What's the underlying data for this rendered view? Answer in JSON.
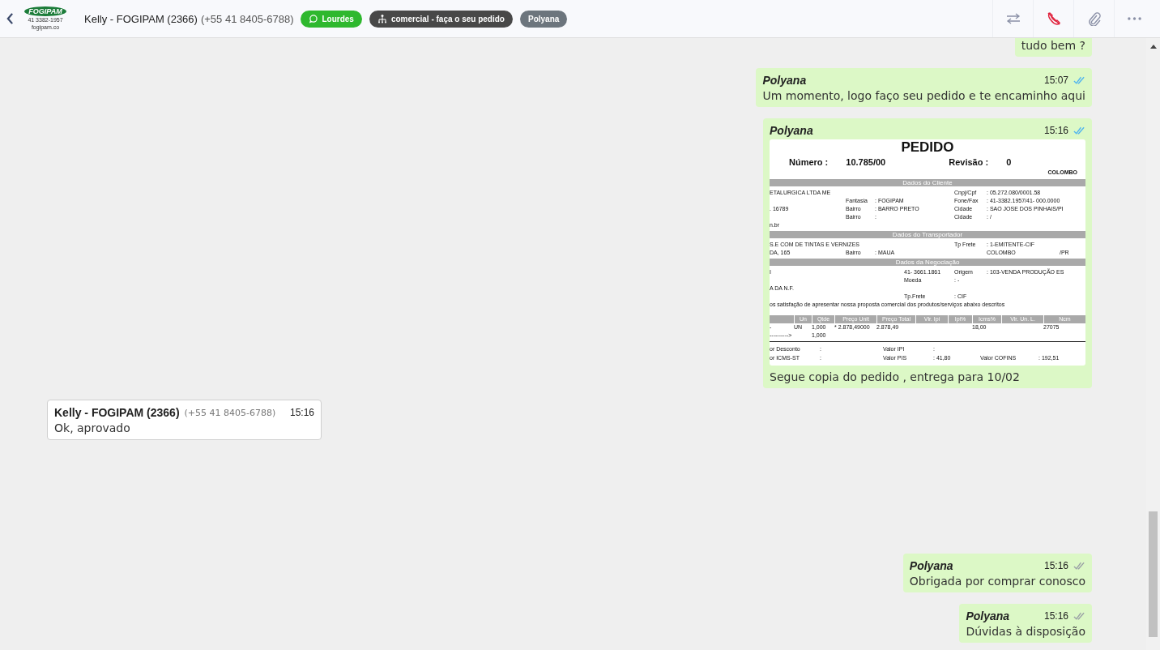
{
  "header": {
    "logo": {
      "name": "FOGIPAM",
      "phone": "41 3382-1957",
      "site": "fogipam.co"
    },
    "contact_name": "Kelly - FOGIPAM (2366)",
    "contact_phone": "(+55 41 8405-6788)",
    "tags": [
      {
        "kind": "whatsapp",
        "label": "Lourdes",
        "color": "#2eb82e"
      },
      {
        "kind": "queue",
        "label": "comercial - faça o seu pedido",
        "color": "#484848"
      },
      {
        "kind": "agent",
        "label": "Polyana",
        "color": "#6c757d"
      }
    ]
  },
  "messages": [
    {
      "kind": "text",
      "outgoing": true,
      "text": "tudo bem ?"
    },
    {
      "kind": "text",
      "outgoing": true,
      "author": "Polyana",
      "time": "15:07",
      "read": true,
      "text": "Um momento, logo faço seu pedido e te encaminho aqui"
    },
    {
      "kind": "document",
      "outgoing": true,
      "author": "Polyana",
      "time": "15:16",
      "read": true,
      "caption": "Segue copia do pedido , entrega para 10/02"
    },
    {
      "kind": "text",
      "outgoing": false,
      "author": "Kelly - FOGIPAM (2366)",
      "phone": "(+55 41 8405-6788)",
      "time": "15:16",
      "text": "Ok, aprovado"
    },
    {
      "kind": "text",
      "outgoing": true,
      "author": "Polyana",
      "time": "15:16",
      "read": false,
      "text": "Obrigada por comprar conosco"
    },
    {
      "kind": "text",
      "outgoing": true,
      "author": "Polyana",
      "time": "15:16",
      "read": false,
      "text": "Dúvidas à disposição"
    }
  ],
  "document": {
    "title": "PEDIDO",
    "number_label": "Número :",
    "number": "10.785/00",
    "revision_label": "Revisão :",
    "revision": "0",
    "city": "COLOMBO",
    "blocks": [
      {
        "kind": "bar",
        "text": "Dados do Cliente"
      },
      {
        "kind": "row",
        "column_1": "ETALURGICA LTDA ME",
        "column_5": "Cnpj/Cpf",
        "column_6": ":  05.272.080/0001.58"
      },
      {
        "kind": "row",
        "column_2": "Fantasia",
        "column_3": ":  FOGIPAM",
        "column_5": "Fone/Fax",
        "column_6": ":  41-3382.1957/41- 000.0000"
      },
      {
        "kind": "row",
        "column_1": ". 16789",
        "column_2": "Bairro",
        "column_3": ":  BARRO PRETO",
        "column_5": "Cidade",
        "column_6": ":  SAO JOSE DOS PINHAIS/PI"
      },
      {
        "kind": "row",
        "column_2": "Bairro",
        "column_3": ":",
        "column_5": "Cidade",
        "column_6": ":  /"
      },
      {
        "kind": "row",
        "column_1": "n.br"
      },
      {
        "kind": "bar",
        "text": "Dados do Transportador"
      },
      {
        "kind": "row",
        "column_1": "S.E COM DE TINTAS E VERNIZES",
        "column_5": "Tp Frete",
        "column_6": ":  1-EMITENTE-CIF"
      },
      {
        "kind": "row",
        "column_1": "DA, 165",
        "column_2": "Bairro",
        "column_3": ":  MAUA",
        "column_6": "COLOMBO",
        "column_7": "/PR"
      },
      {
        "kind": "bar",
        "text": "Dados da Negociação"
      },
      {
        "kind": "row",
        "column_1": "I",
        "column_4": "41- 3661.1861",
        "column_5": "Origem",
        "column_6": ":  103-VENDA PRODUÇÃO ES"
      },
      {
        "kind": "row",
        "column_4": "Moeda",
        "column_5": ":  -"
      },
      {
        "kind": "row",
        "column_1": "A DA N.F."
      },
      {
        "kind": "row",
        "column_4": "Tp.Frete",
        "column_5": ":  CIF"
      },
      {
        "kind": "row",
        "column_1": "os satisfação de apresentar nossa proposta comercial dos produtos/serviços abaixo descritos"
      }
    ],
    "table": {
      "columns": [
        "Un",
        "Qtde",
        "Preço Unit",
        "Preço Total",
        "Vlr. Ipi",
        "Ipi%",
        "Icms%",
        "Vlr. Un. L.",
        "Ncm"
      ],
      "rows": [
        {
          "lead": "-",
          "cells": [
            "UN",
            "1,000",
            "* 2.878,49000",
            "2.878,49",
            "",
            "",
            "18,00",
            "",
            "27075"
          ]
        },
        {
          "lead": "---------->",
          "cells": [
            "",
            "1,000"
          ]
        }
      ]
    },
    "totals": [
      {
        "column_1": "or Desconto",
        "column_2": ":",
        "column_3": "Valor IPI",
        "column_4": ":"
      },
      {
        "column_1": "or ICMS-ST",
        "column_2": ":",
        "column_3": "Valor PIS",
        "column_4": ":  41,80",
        "column_5": "Valor COFINS",
        "column_6": ":  192,51"
      }
    ]
  }
}
